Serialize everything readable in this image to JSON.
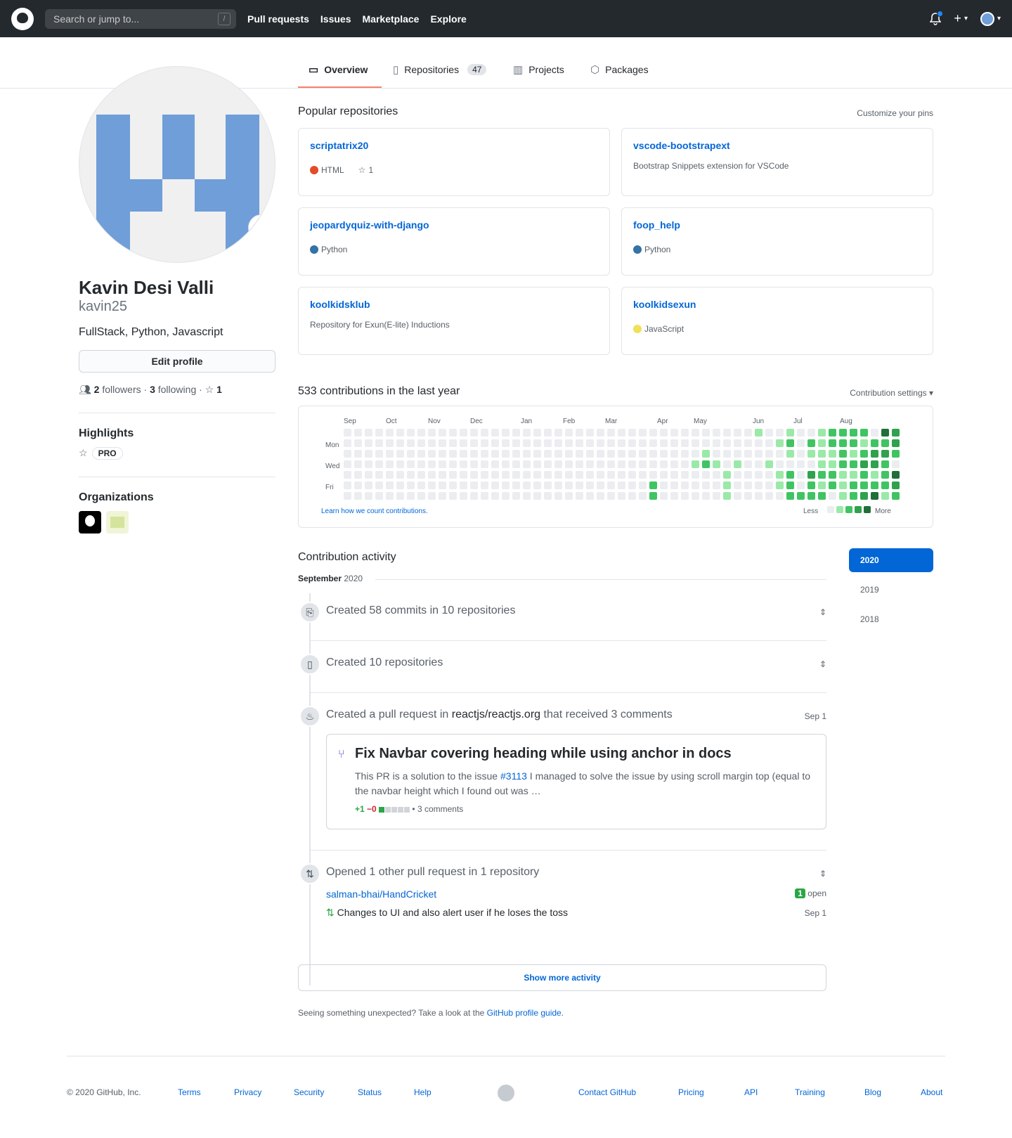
{
  "header": {
    "search_placeholder": "Search or jump to...",
    "slash": "/",
    "nav": [
      "Pull requests",
      "Issues",
      "Marketplace",
      "Explore"
    ],
    "plus": "+"
  },
  "tabs": {
    "overview": "Overview",
    "repositories": "Repositories",
    "repo_count": "47",
    "projects": "Projects",
    "packages": "Packages"
  },
  "profile": {
    "name": "Kavin Desi Valli",
    "login": "kavin25",
    "bio": "FullStack, Python, Javascript",
    "edit": "Edit profile",
    "followers_n": "2",
    "followers": "followers",
    "dot": "·",
    "following_n": "3",
    "following": "following",
    "stars": "1",
    "highlights": "Highlights",
    "pro": "PRO",
    "organizations": "Organizations",
    "avatar_color": "#6f9ed8"
  },
  "popular": {
    "title": "Popular repositories",
    "customize": "Customize your pins",
    "pins": [
      {
        "name": "scriptatrix20",
        "lang": "HTML",
        "color": "#e34c26",
        "stars": "1",
        "desc": ""
      },
      {
        "name": "vscode-bootstrapext",
        "lang": "",
        "color": "",
        "stars": "",
        "desc": "Bootstrap Snippets extension for VSCode"
      },
      {
        "name": "jeopardyquiz-with-django",
        "lang": "Python",
        "color": "#3572A5",
        "stars": "",
        "desc": ""
      },
      {
        "name": "foop_help",
        "lang": "Python",
        "color": "#3572A5",
        "stars": "",
        "desc": ""
      },
      {
        "name": "koolkidsklub",
        "lang": "",
        "color": "",
        "stars": "",
        "desc": "Repository for Exun(E-lite) Inductions"
      },
      {
        "name": "koolkidsexun",
        "lang": "JavaScript",
        "color": "#f1e05a",
        "stars": "",
        "desc": ""
      }
    ]
  },
  "contrib": {
    "title": "533 contributions in the last year",
    "settings": "Contribution settings",
    "months": [
      "Sep",
      "Oct",
      "Nov",
      "Dec",
      "Jan",
      "Feb",
      "Mar",
      "Apr",
      "May",
      "Jun",
      "Jul",
      "Aug"
    ],
    "days": [
      "Mon",
      "Wed",
      "Fri"
    ],
    "learn": "Learn how we count contributions.",
    "less": "Less",
    "more": "More",
    "colors": [
      "#ebedf0",
      "#9be9a8",
      "#40c463",
      "#30a14e",
      "#216e39"
    ]
  },
  "activity": {
    "title": "Contribution activity",
    "month": "September",
    "year": "2020",
    "years": [
      "2020",
      "2019",
      "2018"
    ],
    "commits": "Created 58 commits in 10 repositories",
    "repos": "Created 10 repositories",
    "pr_pre": "Created a pull request in",
    "pr_repo": "reactjs/reactjs.org",
    "pr_post": "that received 3 comments",
    "pr_date": "Sep 1",
    "pr_title": "Fix Navbar covering heading while using anchor in docs",
    "pr_desc_pre": "This PR is a solution to the issue",
    "pr_issue": "#3113",
    "pr_desc_post": "I managed to solve the issue by using scroll margin top (equal to the navbar height which I found out was …",
    "pr_add": "+1",
    "pr_del": "−0",
    "pr_comments": "3 comments",
    "opened": "Opened 1 other pull request in 1 repository",
    "opened_repo": "salman-bhai/HandCricket",
    "open_n": "1",
    "open_label": "open",
    "opened_pr": "Changes to UI and also alert user if he loses the toss",
    "opened_date": "Sep 1",
    "show_more": "Show more activity",
    "unexpected_pre": "Seeing something unexpected? Take a look at the",
    "guide": "GitHub profile guide",
    "unexpected_post": "."
  },
  "footer": {
    "copyright": "© 2020 GitHub, Inc.",
    "links": [
      "Terms",
      "Privacy",
      "Security",
      "Status",
      "Help",
      "Contact GitHub",
      "Pricing",
      "API",
      "Training",
      "Blog",
      "About"
    ]
  }
}
